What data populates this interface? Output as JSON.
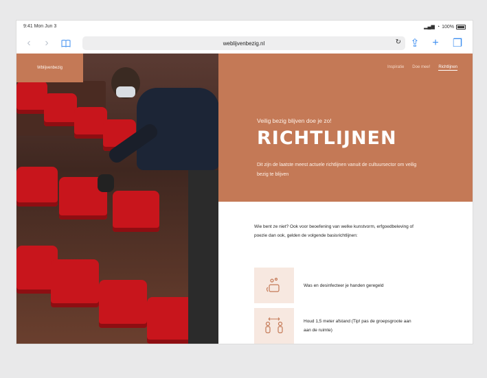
{
  "status": {
    "time": "9:41",
    "date": "Mon Jun 3",
    "battery": "100%"
  },
  "browser": {
    "url": "weblijvenbezig.nl"
  },
  "site": {
    "brand": "Wblijvenbezig",
    "nav": [
      "Inspiratie",
      "Doe mee!",
      "Richtlijnen"
    ],
    "kicker": "Veilig bezig blijven doe je zo!",
    "title": "RICHTLIJNEN",
    "subtitle": "Dit zijn de laatste meest actuele richtlijnen vanuit de cultuursector om veilig bezig te blijven",
    "intro": "Wie bent ze niet? Ook voor beoefening van welke kunstvorm, erfgoedbeleving of poezie dan ook, gelden de volgende basisrichtlijnen:",
    "guidelines": [
      {
        "icon": "hand-wash-icon",
        "text": "Was en desinfecteer je handen geregeld"
      },
      {
        "icon": "distance-icon",
        "text": "Houd 1,5 meter afstand (Tip! pas de groepsgroote aan aan de ruimte)"
      }
    ]
  },
  "colors": {
    "accent": "#c47956",
    "link": "#3d8ef0"
  }
}
